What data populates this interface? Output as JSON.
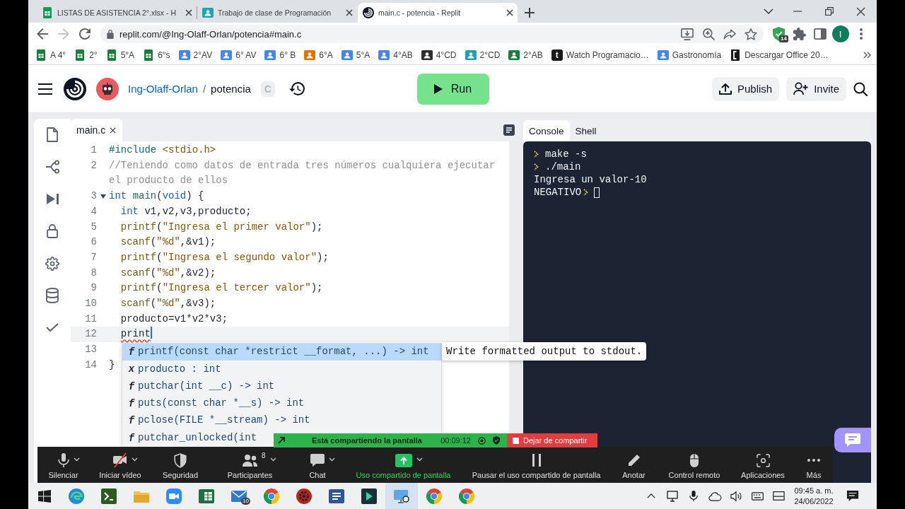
{
  "browser": {
    "tabs": [
      {
        "title": "LISTAS DE ASISTENCIA 2°.xlsx - H",
        "kind": "sheet",
        "selected": false
      },
      {
        "title": "Trabajo de clase de Programación",
        "kind": "classroom",
        "selected": false
      },
      {
        "title": "main.c - potencia - Replit",
        "kind": "spiral",
        "selected": true
      }
    ],
    "forward_disabled": true,
    "address": "replit.com/@Ing-Olaff-Orlan/potencia#main.c",
    "extension_badge": "14",
    "profile_initial": "I",
    "bookmarks": [
      {
        "label": "A 4°",
        "kind": "sheet",
        "color": "#188038"
      },
      {
        "label": "2°",
        "kind": "sheet",
        "color": "#188038"
      },
      {
        "label": "5°A",
        "kind": "sheet",
        "color": "#188038"
      },
      {
        "label": "6°s",
        "kind": "sheet",
        "color": "#188038"
      },
      {
        "label": "2°AV",
        "kind": "classroom",
        "color": "#4285f4"
      },
      {
        "label": "6° AV",
        "kind": "classroom",
        "color": "#4285f4"
      },
      {
        "label": "6° B",
        "kind": "classroom",
        "color": "#4285f4"
      },
      {
        "label": "6°A",
        "kind": "classroom",
        "color": "#e37400"
      },
      {
        "label": "5°A",
        "kind": "classroom",
        "color": "#4285f4"
      },
      {
        "label": "4°AB",
        "kind": "classroom",
        "color": "#4285f4"
      },
      {
        "label": "4°CD",
        "kind": "classroom",
        "color": "#303030"
      },
      {
        "label": "2°CD",
        "kind": "classroom",
        "color": "#1fa3b3"
      },
      {
        "label": "2°AB",
        "kind": "classroom",
        "color": "#188038"
      },
      {
        "label": "Watch Programacio…",
        "kind": "letter",
        "icon_text": "t",
        "color": "#1a1a1a"
      },
      {
        "label": "Gastronomía",
        "kind": "classroom",
        "color": "#4285f4"
      },
      {
        "label": "Descargar Office 20…",
        "kind": "document",
        "color": "#1a1a1a"
      }
    ]
  },
  "replit": {
    "owner": "Ing-Olaff-Orlan",
    "separator": "/",
    "repl_name": "potencia",
    "language_badge": "C",
    "run_label": "Run",
    "publish_label": "Publish",
    "invite_label": "Invite",
    "file_tabs": [
      {
        "name": "main.c",
        "selected": true
      }
    ],
    "code": [
      {
        "number": "1",
        "fold": false,
        "current": false,
        "tokens": [
          {
            "text": "#include",
            "kind": "directive"
          },
          {
            "text": " <stdio.h>",
            "kind": "string"
          }
        ]
      },
      {
        "number": "2",
        "fold": false,
        "current": false,
        "tokens": [
          {
            "text": "//Teniendo como datos de entrada tres números cualquiera ejecutar el producto de ellos",
            "kind": "comment"
          }
        ]
      },
      {
        "number": "3",
        "fold": true,
        "current": false,
        "tokens": [
          {
            "text": "int",
            "kind": "keyword"
          },
          {
            "text": " main",
            "kind": "definition"
          },
          {
            "text": "(",
            "kind": "plain"
          },
          {
            "text": "void",
            "kind": "keyword"
          },
          {
            "text": ") {",
            "kind": "plain"
          }
        ]
      },
      {
        "number": "4",
        "fold": false,
        "current": false,
        "tokens": [
          {
            "text": "  int",
            "kind": "keyword"
          },
          {
            "text": " v1,v2,v3,producto;",
            "kind": "plain"
          }
        ]
      },
      {
        "number": "5",
        "fold": false,
        "current": false,
        "tokens": [
          {
            "text": "  printf",
            "kind": "function"
          },
          {
            "text": "(",
            "kind": "plain"
          },
          {
            "text": "\"Ingresa el primer valor\"",
            "kind": "string"
          },
          {
            "text": ");",
            "kind": "plain"
          }
        ]
      },
      {
        "number": "6",
        "fold": false,
        "current": false,
        "tokens": [
          {
            "text": "  scanf",
            "kind": "function"
          },
          {
            "text": "(",
            "kind": "plain"
          },
          {
            "text": "\"%d\"",
            "kind": "string"
          },
          {
            "text": ",&v1);",
            "kind": "plain"
          }
        ]
      },
      {
        "number": "7",
        "fold": false,
        "current": false,
        "tokens": [
          {
            "text": "  printf",
            "kind": "function"
          },
          {
            "text": "(",
            "kind": "plain"
          },
          {
            "text": "\"Ingresa el segundo valor\"",
            "kind": "string"
          },
          {
            "text": ");",
            "kind": "plain"
          }
        ]
      },
      {
        "number": "8",
        "fold": false,
        "current": false,
        "tokens": [
          {
            "text": "  scanf",
            "kind": "function"
          },
          {
            "text": "(",
            "kind": "plain"
          },
          {
            "text": "\"%d\"",
            "kind": "string"
          },
          {
            "text": ",&v2);",
            "kind": "plain"
          }
        ]
      },
      {
        "number": "9",
        "fold": false,
        "current": false,
        "tokens": [
          {
            "text": "  printf",
            "kind": "function"
          },
          {
            "text": "(",
            "kind": "plain"
          },
          {
            "text": "\"Ingresa el tercer valor\"",
            "kind": "string"
          },
          {
            "text": ");",
            "kind": "plain"
          }
        ]
      },
      {
        "number": "10",
        "fold": false,
        "current": false,
        "tokens": [
          {
            "text": "  scanf",
            "kind": "function"
          },
          {
            "text": "(",
            "kind": "plain"
          },
          {
            "text": "\"%d\"",
            "kind": "string"
          },
          {
            "text": ",&v3);",
            "kind": "plain"
          }
        ]
      },
      {
        "number": "11",
        "fold": false,
        "current": false,
        "tokens": [
          {
            "text": "  producto=v1*v2*v3;",
            "kind": "plain"
          }
        ]
      },
      {
        "number": "12",
        "fold": false,
        "current": true,
        "tokens": [
          {
            "text": "  print",
            "kind": "error"
          }
        ]
      },
      {
        "number": "13",
        "fold": false,
        "current": false
      },
      {
        "number": "14",
        "fold": false,
        "current": false,
        "tokens": [
          {
            "text": "}",
            "kind": "plain"
          }
        ]
      }
    ],
    "autocomplete": [
      {
        "icon": "f",
        "text": "printf(const char *restrict __format, ...) -> int",
        "selected": true
      },
      {
        "icon": "x",
        "text": "producto : int",
        "selected": false
      },
      {
        "icon": "f",
        "text": "putchar(int __c) -> int",
        "selected": false
      },
      {
        "icon": "f",
        "text": "puts(const char *__s) -> int",
        "selected": false
      },
      {
        "icon": "f",
        "text": "pclose(FILE *__stream) -> int",
        "selected": false
      },
      {
        "icon": "f",
        "text": "putchar_unlocked(int",
        "selected": false
      }
    ],
    "tooltip": "Write formatted output to stdout.",
    "panel_tabs": [
      {
        "label": "Console",
        "selected": true
      },
      {
        "label": "Shell",
        "selected": false
      }
    ],
    "console": [
      {
        "kind": "command",
        "text": "make -s"
      },
      {
        "kind": "command",
        "text": "./main"
      },
      {
        "kind": "output",
        "text": "Ingresa un valor-10"
      },
      {
        "kind": "input",
        "text": "NEGATIVO"
      }
    ]
  },
  "zoom": {
    "banner": {
      "status": "Está compartiendo la pantalla",
      "timer": "00:09:12",
      "stop_label": "Dejar de compartir"
    },
    "toolbar": [
      {
        "label": "Silenciar",
        "kind": "mic",
        "caret": true
      },
      {
        "label": "Iniciar vídeo",
        "kind": "video_off",
        "caret": true
      },
      {
        "label": "Seguridad",
        "kind": "shield",
        "caret": false
      },
      {
        "label": "Participantes",
        "kind": "participants",
        "count": "8",
        "caret": true
      },
      {
        "label": "Chat",
        "kind": "chat",
        "caret": true
      },
      {
        "label": "Uso compartido de pantalla",
        "kind": "share",
        "caret": true
      },
      {
        "label": "Pausar el uso compartido de pantalla",
        "kind": "pause",
        "caret": false
      },
      {
        "label": "Anotar",
        "kind": "pen",
        "caret": false
      },
      {
        "label": "Control remoto",
        "kind": "mouse",
        "caret": false
      },
      {
        "label": "Aplicaciones",
        "kind": "apps",
        "caret": false
      },
      {
        "label": "Más",
        "kind": "more",
        "caret": false
      }
    ]
  },
  "taskbar": {
    "apps": [
      {
        "kind": "swirl",
        "selected": false
      },
      {
        "kind": "app_tile",
        "selected": false
      },
      {
        "kind": "folder",
        "selected": false
      },
      {
        "kind": "video",
        "selected": false
      },
      {
        "kind": "spreadsheet",
        "selected": false
      },
      {
        "kind": "mail",
        "badge": "10",
        "selected": false
      },
      {
        "kind": "browser",
        "selected": false
      },
      {
        "kind": "cog",
        "selected": false
      },
      {
        "kind": "document",
        "selected": false
      },
      {
        "kind": "arrow_tile",
        "selected": false
      },
      {
        "kind": "monitor",
        "selected": true
      },
      {
        "kind": "browser",
        "selected": false
      },
      {
        "kind": "browser",
        "selected": false
      }
    ],
    "time": "09:45 a. m.",
    "date": "24/06/2022"
  }
}
